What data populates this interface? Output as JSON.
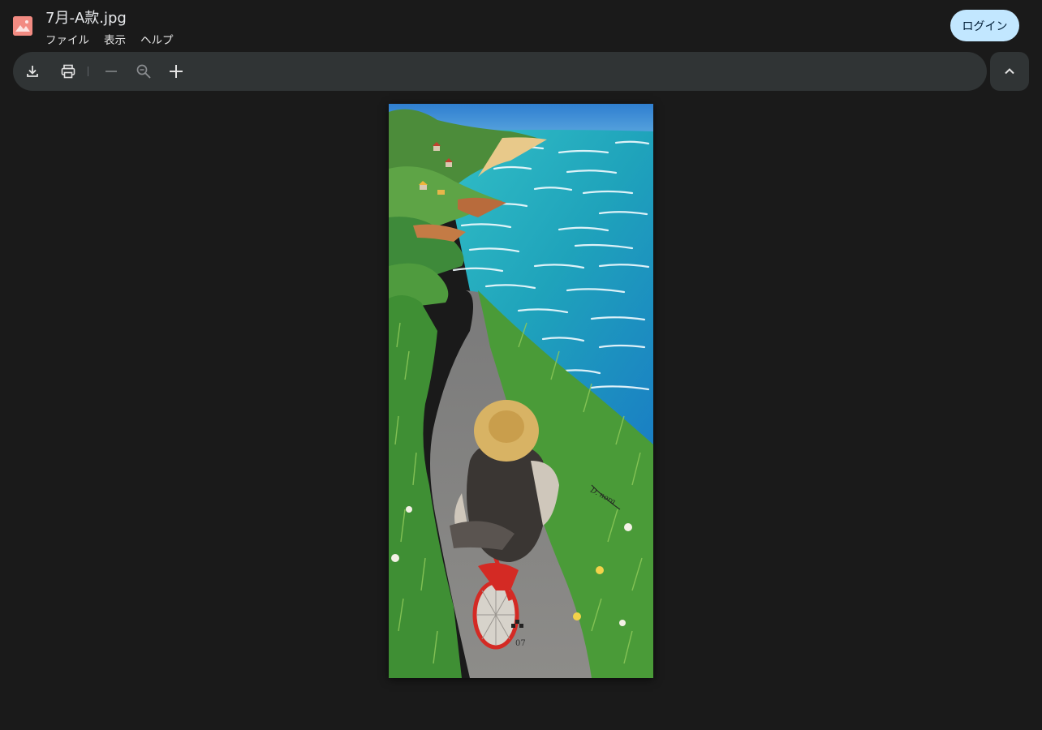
{
  "window": {
    "title": "7月-A款.jpg",
    "icon": "image-icon",
    "accent_color": "#f28b82"
  },
  "menu": [
    {
      "label": "ファイル"
    },
    {
      "label": "表示"
    },
    {
      "label": "ヘルプ"
    }
  ],
  "header": {
    "login_label": "ログイン",
    "login_color": "#c2e7ff"
  },
  "toolbar": {
    "tools": [
      {
        "icon": "download-icon"
      },
      {
        "icon": "print-icon"
      },
      {
        "icon": "zoom-out-minus-icon"
      },
      {
        "icon": "zoom-reset-icon"
      },
      {
        "icon": "zoom-in-plus-icon"
      }
    ],
    "collapse_icon": "chevron-up-icon"
  },
  "artwork": {
    "page_number": "07",
    "signature": "D. nora",
    "colors": {
      "sea": "#22a2bd",
      "sky": "#3c8fd6",
      "grass": "#4c9a3a",
      "path": "#858585",
      "bicycle": "#d42a24",
      "hat": "#d8b364"
    }
  }
}
